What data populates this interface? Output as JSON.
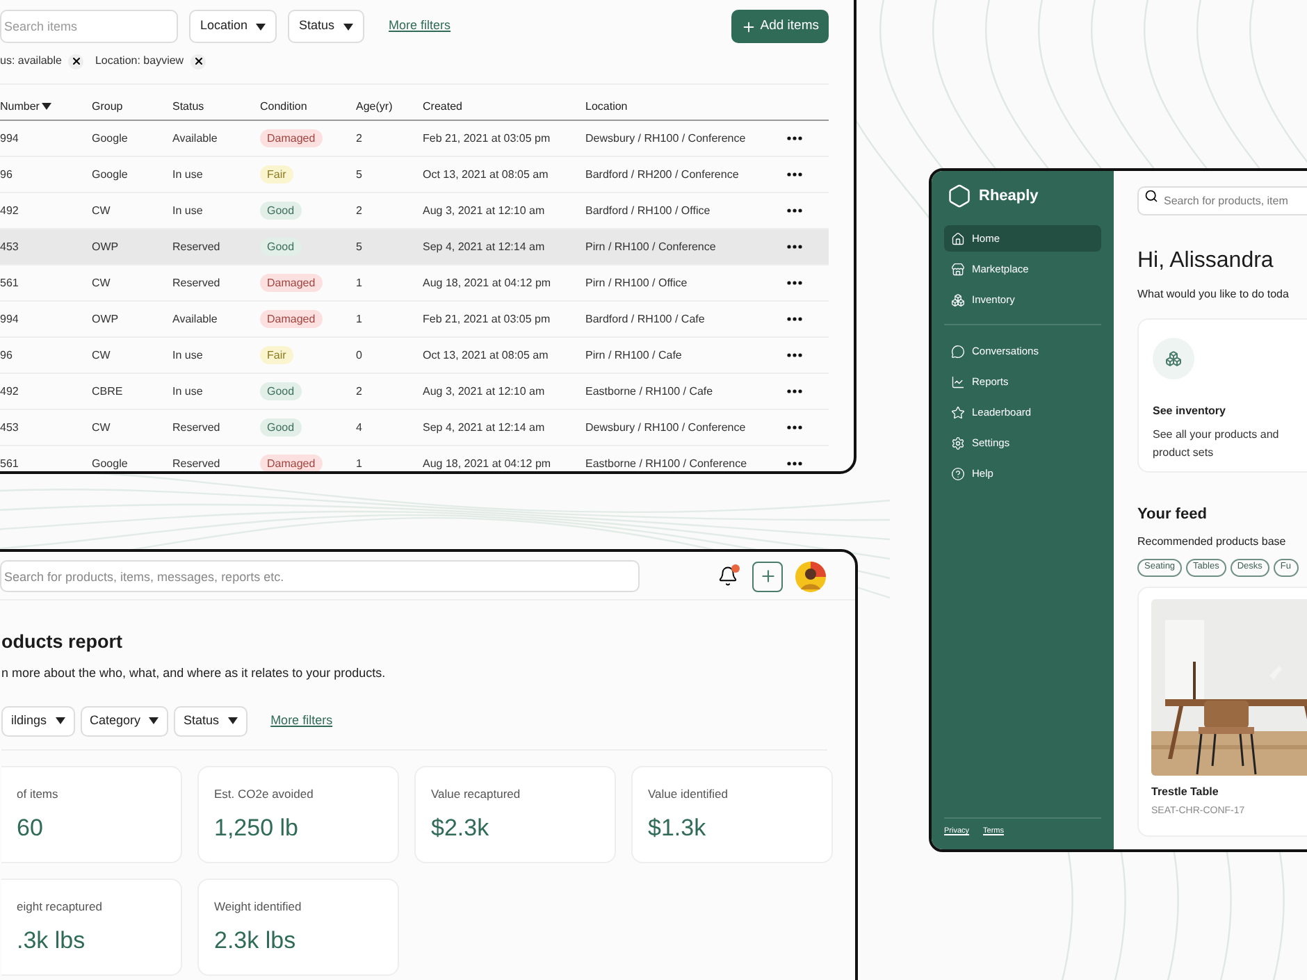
{
  "inventory_window": {
    "search": {
      "placeholder": "Search items"
    },
    "filters": [
      "Location",
      "Status"
    ],
    "more_filters": "More filters",
    "add_button": "Add items",
    "chips": [
      "us: available",
      "Location: bayview"
    ],
    "columns": [
      "Number",
      "Group",
      "Status",
      "Condition",
      "Age(yr)",
      "Created",
      "Location"
    ],
    "rows": [
      {
        "number": "994",
        "group": "Google",
        "status": "Available",
        "condition": {
          "label": "Damaged",
          "kind": "bad"
        },
        "age": "2",
        "created": "Feb 21, 2021 at 03:05 pm",
        "location": "Dewsbury / RH100 / Conference",
        "hovered": false
      },
      {
        "number": "96",
        "group": "Google",
        "status": "In use",
        "condition": {
          "label": "Fair",
          "kind": "fair"
        },
        "age": "5",
        "created": "Oct 13, 2021 at 08:05 am",
        "location": "Bardford / RH200 / Conference",
        "hovered": false
      },
      {
        "number": "492",
        "group": "CW",
        "status": "In use",
        "condition": {
          "label": "Good",
          "kind": "good"
        },
        "age": "2",
        "created": "Aug 3, 2021 at 12:10 am",
        "location": "Bardford / RH100 / Office",
        "hovered": false
      },
      {
        "number": "453",
        "group": "OWP",
        "status": "Reserved",
        "condition": {
          "label": "Good",
          "kind": "good"
        },
        "age": "5",
        "created": "Sep 4, 2021 at 12:14 am",
        "location": "Pirn / RH100 / Conference",
        "hovered": true
      },
      {
        "number": "561",
        "group": "CW",
        "status": "Reserved",
        "condition": {
          "label": "Damaged",
          "kind": "bad"
        },
        "age": "1",
        "created": "Aug 18, 2021 at 04:12 pm",
        "location": "Pirn / RH100 / Office",
        "hovered": false
      },
      {
        "number": "994",
        "group": "OWP",
        "status": "Available",
        "condition": {
          "label": "Damaged",
          "kind": "bad"
        },
        "age": "1",
        "created": "Feb 21, 2021 at 03:05 pm",
        "location": "Bardford / RH100 / Cafe",
        "hovered": false
      },
      {
        "number": "96",
        "group": "CW",
        "status": "In use",
        "condition": {
          "label": "Fair",
          "kind": "fair"
        },
        "age": "0",
        "created": "Oct 13, 2021 at 08:05 am",
        "location": "Pirn / RH100 / Cafe",
        "hovered": false
      },
      {
        "number": "492",
        "group": "CBRE",
        "status": "In use",
        "condition": {
          "label": "Good",
          "kind": "good"
        },
        "age": "2",
        "created": "Aug 3, 2021 at 12:10 am",
        "location": "Eastborne / RH100 / Cafe",
        "hovered": false
      },
      {
        "number": "453",
        "group": "CW",
        "status": "Reserved",
        "condition": {
          "label": "Good",
          "kind": "good"
        },
        "age": "4",
        "created": "Sep 4, 2021 at 12:14 am",
        "location": "Dewsbury / RH100 / Conference",
        "hovered": false
      },
      {
        "number": "561",
        "group": "Google",
        "status": "Reserved",
        "condition": {
          "label": "Damaged",
          "kind": "bad"
        },
        "age": "1",
        "created": "Aug 18, 2021 at 04:12 pm",
        "location": "Eastborne / RH100 / Conference",
        "hovered": false
      }
    ]
  },
  "report_window": {
    "search": {
      "placeholder": "Search for products, items, messages, reports etc."
    },
    "notification_unread": true,
    "title": "oducts report",
    "subtitle": "n more about the who, what, and where as it relates to your products.",
    "filters": [
      "ildings",
      "Category",
      "Status"
    ],
    "more_filters": "More filters",
    "metrics": [
      {
        "label": "of items",
        "value": "60"
      },
      {
        "label": "Est. CO2e avoided",
        "value": "1,250 lb"
      },
      {
        "label": "Value recaptured",
        "value": "$2.3k"
      },
      {
        "label": "Value identified",
        "value": "$1.3k"
      },
      {
        "label": "eight recaptured",
        "value": ".3k lbs"
      },
      {
        "label": "Weight identified",
        "value": "2.3k lbs"
      }
    ]
  },
  "home_window": {
    "brand": "Rheaply",
    "nav_groups": [
      [
        {
          "label": "Home",
          "selected": true
        },
        {
          "label": "Marketplace",
          "selected": false
        },
        {
          "label": "Inventory",
          "selected": false
        }
      ],
      [
        {
          "label": "Conversations",
          "selected": false
        },
        {
          "label": "Reports",
          "selected": false
        },
        {
          "label": "Leaderboard",
          "selected": false
        },
        {
          "label": "Settings",
          "selected": false
        },
        {
          "label": "Help",
          "selected": false
        }
      ]
    ],
    "footer_links": [
      "Privacy",
      "Terms"
    ],
    "search": {
      "placeholder": "Search for products, item"
    },
    "greeting": "Hi, Alissandra",
    "prompt": "What would you like to do toda",
    "card": {
      "title": "See inventory",
      "text": "See all your products and product sets"
    },
    "feed": {
      "title": "Your feed",
      "subtitle": "Recommended products base",
      "tags": [
        "Seating",
        "Tables",
        "Desks",
        "Fu"
      ],
      "product": {
        "kind": "picture",
        "name": "Trestle Table",
        "sku": "SEAT-CHR-CONF-17"
      }
    }
  }
}
